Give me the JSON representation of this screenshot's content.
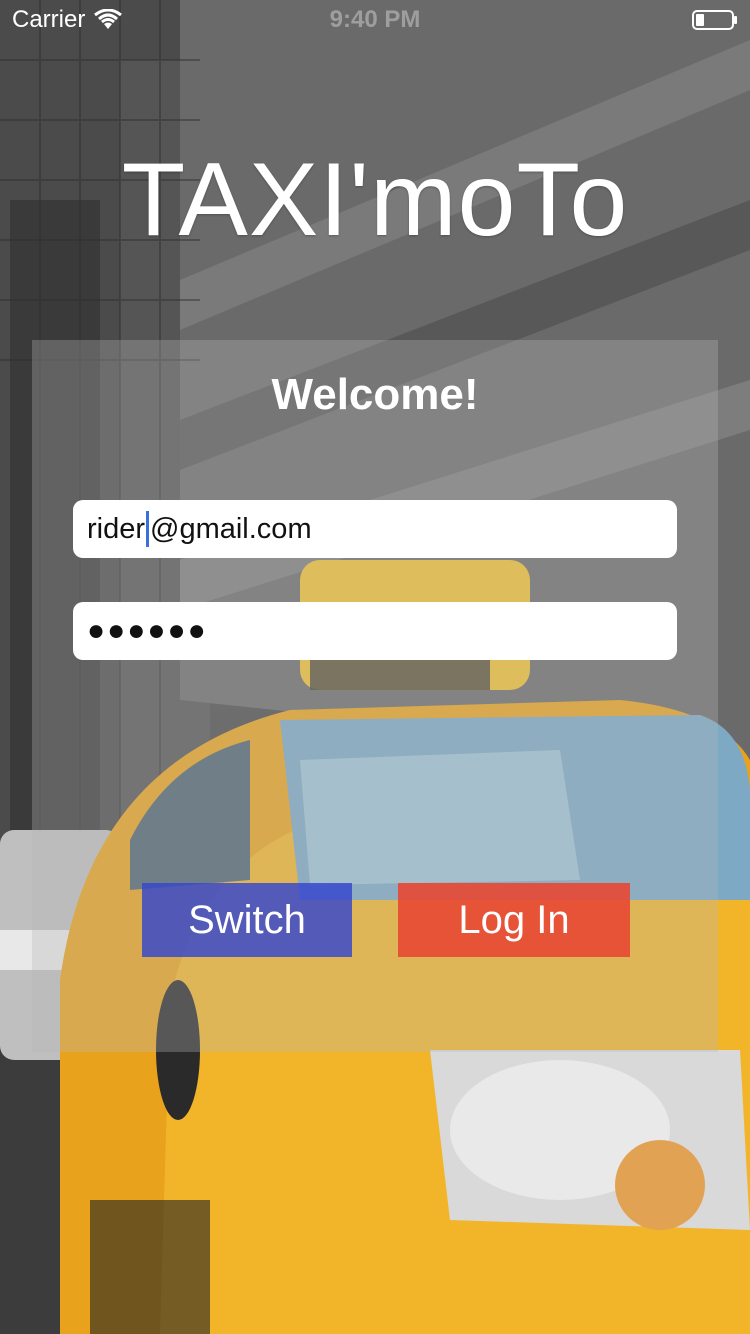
{
  "status_bar": {
    "carrier": "Carrier",
    "time": "9:40 PM"
  },
  "app": {
    "title": "TAXI'moTo"
  },
  "login": {
    "welcome": "Welcome!",
    "email_before_caret": "rider",
    "email_after_caret": "@gmail.com",
    "password_masked": "●●●●●●",
    "switch_label": "Switch",
    "login_label": "Log In"
  },
  "colors": {
    "switch_button": "#3446CD",
    "login_button": "#E84834",
    "caret": "#3B6FE0"
  },
  "icons": {
    "wifi": "wifi-icon",
    "battery": "battery-icon"
  }
}
